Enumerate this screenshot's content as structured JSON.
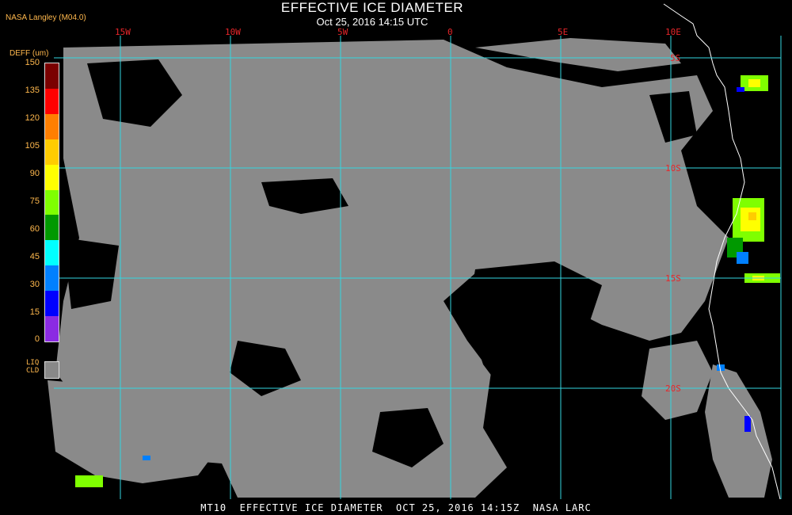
{
  "header": {
    "title": "EFFECTIVE ICE DIAMETER",
    "subtitle": "Oct 25, 2016 14:15 UTC",
    "source": "NASA Langley (M04.0)"
  },
  "legend": {
    "title": "DEFF (um)",
    "ticks": [
      "150",
      "135",
      "120",
      "105",
      "90",
      "75",
      "60",
      "45",
      "30",
      "15",
      "0"
    ],
    "colors": [
      "#7a0000",
      "#ff0000",
      "#ff7f00",
      "#ffcc00",
      "#ffff00",
      "#7fff00",
      "#009900",
      "#00ffff",
      "#0080ff",
      "#0000ff",
      "#8b2be2"
    ],
    "liquid_cloud_label": [
      "LIQ",
      "CLD"
    ],
    "liquid_cloud_color": "#888888"
  },
  "map": {
    "longitude_labels": [
      "15W",
      "10W",
      "5W",
      "0",
      "5E",
      "10E"
    ],
    "latitude_labels": [
      "5S",
      "10S",
      "15S",
      "20S"
    ],
    "grid_color": "#33d6e0",
    "label_color": "#e8262a",
    "cloud_color": "#8a8a8a",
    "coast_color": "#ffffff"
  },
  "footer": {
    "text": "MT10  EFFECTIVE ICE DIAMETER  OCT 25, 2016 14:15Z  NASA LARC"
  }
}
